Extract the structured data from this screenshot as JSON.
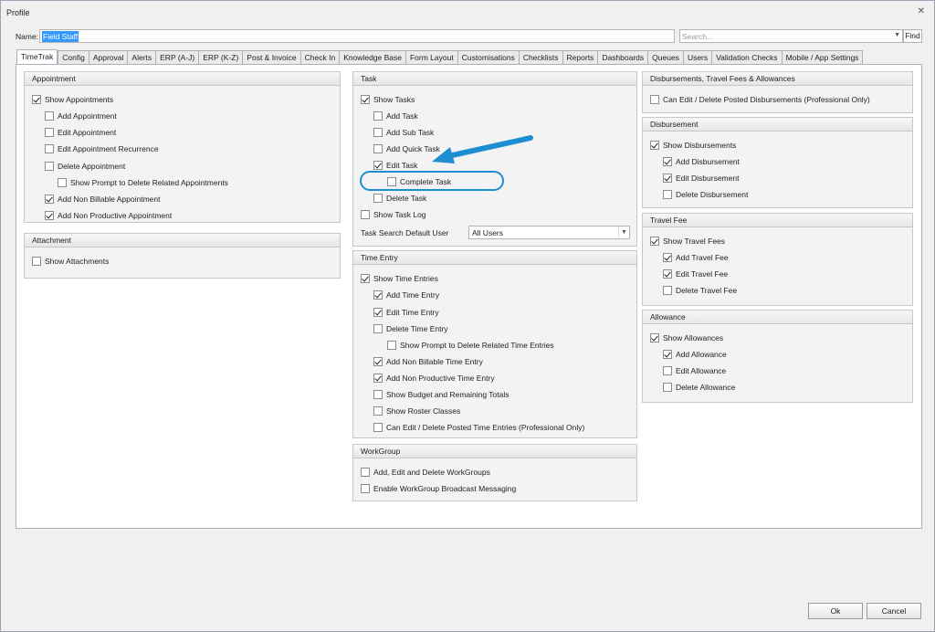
{
  "window": {
    "title": "Profile"
  },
  "name_field": {
    "label": "Name:",
    "value": "Field Staff"
  },
  "search": {
    "placeholder": "Search...",
    "find_label": "Find"
  },
  "tabs": [
    "TimeTrak",
    "Config",
    "Approval",
    "Alerts",
    "ERP (A-J)",
    "ERP (K-Z)",
    "Post & Invoice",
    "Check In",
    "Knowledge Base",
    "Form Layout",
    "Customisations",
    "Checklists",
    "Reports",
    "Dashboards",
    "Queues",
    "Users",
    "Validation Checks",
    "Mobile / App Settings"
  ],
  "groups": {
    "appointment": {
      "title": "Appointment",
      "items": [
        {
          "label": "Show Appointments",
          "checked": true
        },
        {
          "label": "Add Appointment",
          "checked": false
        },
        {
          "label": "Edit Appointment",
          "checked": false
        },
        {
          "label": "Edit Appointment Recurrence",
          "checked": false
        },
        {
          "label": "Delete Appointment",
          "checked": false
        },
        {
          "label": "Show Prompt to Delete Related Appointments",
          "checked": false
        },
        {
          "label": "Add Non Billable Appointment",
          "checked": true
        },
        {
          "label": "Add Non Productive Appointment",
          "checked": true
        }
      ]
    },
    "attachment": {
      "title": "Attachment",
      "items": [
        {
          "label": "Show Attachments",
          "checked": false
        }
      ]
    },
    "task": {
      "title": "Task",
      "items": [
        {
          "label": "Show Tasks",
          "checked": true
        },
        {
          "label": "Add Task",
          "checked": false
        },
        {
          "label": "Add Sub Task",
          "checked": false
        },
        {
          "label": "Add Quick Task",
          "checked": false
        },
        {
          "label": "Edit Task",
          "checked": true
        },
        {
          "label": "Complete Task",
          "checked": false
        },
        {
          "label": "Delete Task",
          "checked": false
        },
        {
          "label": "Show Task Log",
          "checked": false
        }
      ],
      "search_user_label": "Task Search Default User",
      "search_user_value": "All Users"
    },
    "time_entry": {
      "title": "Time Entry",
      "items": [
        {
          "label": "Show Time Entries",
          "checked": true
        },
        {
          "label": "Add Time Entry",
          "checked": true
        },
        {
          "label": "Edit Time Entry",
          "checked": true
        },
        {
          "label": "Delete Time Entry",
          "checked": false
        },
        {
          "label": "Show Prompt to Delete Related Time Entries",
          "checked": false
        },
        {
          "label": "Add Non Billable Time Entry",
          "checked": true
        },
        {
          "label": "Add Non Productive Time Entry",
          "checked": true
        },
        {
          "label": "Show Budget and Remaining Totals",
          "checked": false
        },
        {
          "label": "Show Roster Classes",
          "checked": false
        },
        {
          "label": "Can Edit / Delete Posted Time Entries (Professional Only)",
          "checked": false
        }
      ]
    },
    "workgroup": {
      "title": "WorkGroup",
      "items": [
        {
          "label": "Add, Edit and Delete WorkGroups",
          "checked": false
        },
        {
          "label": "Enable WorkGroup Broadcast Messaging",
          "checked": false
        }
      ]
    },
    "disb_travel": {
      "title": "Disbursements, Travel Fees & Allowances",
      "items": [
        {
          "label": "Can Edit / Delete Posted Disbursements (Professional Only)",
          "checked": false
        }
      ]
    },
    "disbursement": {
      "title": "Disbursement",
      "items": [
        {
          "label": "Show Disbursements",
          "checked": true
        },
        {
          "label": "Add Disbursement",
          "checked": true
        },
        {
          "label": "Edit Disbursement",
          "checked": true
        },
        {
          "label": "Delete Disbursement",
          "checked": false
        }
      ]
    },
    "travel_fee": {
      "title": "Travel Fee",
      "items": [
        {
          "label": "Show Travel Fees",
          "checked": true
        },
        {
          "label": "Add Travel Fee",
          "checked": true
        },
        {
          "label": "Edit Travel Fee",
          "checked": true
        },
        {
          "label": "Delete Travel Fee",
          "checked": false
        }
      ]
    },
    "allowance": {
      "title": "Allowance",
      "items": [
        {
          "label": "Show Allowances",
          "checked": true
        },
        {
          "label": "Add Allowance",
          "checked": true
        },
        {
          "label": "Edit Allowance",
          "checked": false
        },
        {
          "label": "Delete Allowance",
          "checked": false
        }
      ]
    }
  },
  "buttons": {
    "ok": "Ok",
    "cancel": "Cancel"
  },
  "colors": {
    "accent": "#1e8ed2",
    "selection": "#3399ff"
  }
}
